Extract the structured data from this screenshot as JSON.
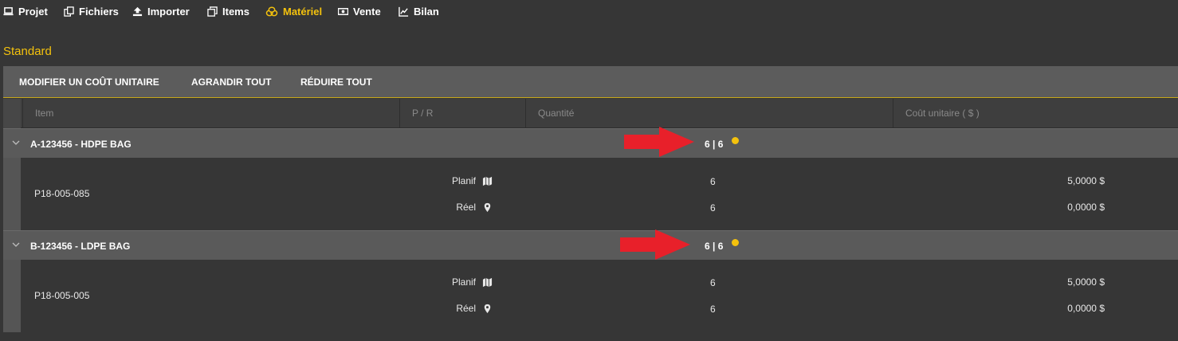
{
  "nav": {
    "items": [
      {
        "label": "Projet",
        "icon": "laptop-icon",
        "active": false
      },
      {
        "label": "Fichiers",
        "icon": "copy-files-icon",
        "active": false
      },
      {
        "label": "Importer",
        "icon": "upload-icon",
        "active": false
      },
      {
        "label": "Items",
        "icon": "clone-icon",
        "active": false
      },
      {
        "label": "Matériel",
        "icon": "coins-icon",
        "active": true
      },
      {
        "label": "Vente",
        "icon": "money-bill-icon",
        "active": false
      },
      {
        "label": "Bilan",
        "icon": "line-chart-icon",
        "active": false
      }
    ],
    "active_color": "#f4c20d"
  },
  "section": {
    "title": "Standard"
  },
  "toolbar": {
    "modify_label": "MODIFIER UN COÛT UNITAIRE",
    "expand_label": "AGRANDIR TOUT",
    "collapse_label": "RÉDUIRE TOUT"
  },
  "table": {
    "headers": [
      "Item",
      "P / R",
      "Quantité",
      "Coût unitaire ( $ )"
    ],
    "groups": [
      {
        "title": "A-123456 - HDPE BAG",
        "quantity": "6 | 6",
        "item_id": "P18-005-085",
        "rows": [
          {
            "pr": "Planif",
            "pr_icon": "map-icon",
            "qty": "6",
            "cost": "5,0000 $"
          },
          {
            "pr": "Réel",
            "pr_icon": "map-marker-icon",
            "qty": "6",
            "cost": "0,0000 $"
          }
        ]
      },
      {
        "title": "B-123456 - LDPE BAG",
        "quantity": "6 | 6",
        "item_id": "P18-005-005",
        "rows": [
          {
            "pr": "Planif",
            "pr_icon": "map-icon",
            "qty": "6",
            "cost": "5,0000 $"
          },
          {
            "pr": "Réel",
            "pr_icon": "map-marker-icon",
            "qty": "6",
            "cost": "0,0000 $"
          }
        ]
      }
    ]
  },
  "colors": {
    "accent": "#f4c20d",
    "annotation_arrow": "#e8202a",
    "background": "#363636",
    "toolbar": "#5c5c5c",
    "group_row": "#5a5a5a"
  }
}
